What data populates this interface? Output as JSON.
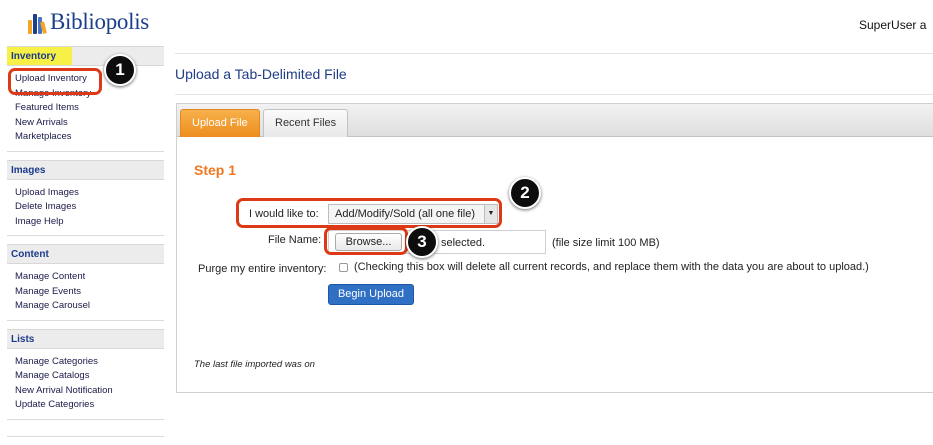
{
  "app": {
    "logo_text": "Bibliopolis",
    "user_label": "SuperUser a"
  },
  "sidebar": {
    "sections": [
      {
        "title": "Inventory",
        "items": [
          "Upload Inventory",
          "Manage Inventory",
          "Featured Items",
          "New Arrivals",
          "Marketplaces"
        ]
      },
      {
        "title": "Images",
        "items": [
          "Upload Images",
          "Delete Images",
          "Image Help"
        ]
      },
      {
        "title": "Content",
        "items": [
          "Manage Content",
          "Manage Events",
          "Manage Carousel"
        ]
      },
      {
        "title": "Lists",
        "items": [
          "Manage Categories",
          "Manage Catalogs",
          "New Arrival Notification",
          "Update Categories"
        ]
      }
    ]
  },
  "main": {
    "title": "Upload a Tab-Delimited File",
    "tabs": [
      {
        "label": "Upload File",
        "active": true
      },
      {
        "label": "Recent Files",
        "active": false
      }
    ],
    "step_label": "Step 1",
    "form": {
      "action_label": "I would like to:",
      "action_value": "Add/Modify/Sold (all one file)",
      "file_label": "File Name:",
      "browse_label": "Browse...",
      "file_status": "selected.",
      "file_hint": "(file size limit 100 MB)",
      "purge_label": "Purge my entire inventory:",
      "purge_checked": false,
      "purge_hint": "(Checking this box will delete all current records, and replace them with the data you are about to upload.)",
      "submit_label": "Begin Upload"
    },
    "last_import_text": "The last file imported was on"
  },
  "annotations": [
    {
      "number": "1",
      "target": "Upload Inventory"
    },
    {
      "number": "2",
      "target": "I would like to: select"
    },
    {
      "number": "3",
      "target": "Browse... button"
    }
  ],
  "colors": {
    "accent_orange": "#f07820",
    "brand_blue": "#1f3c86",
    "callout_red": "#dc3a17",
    "button_blue": "#2f6fc4"
  }
}
